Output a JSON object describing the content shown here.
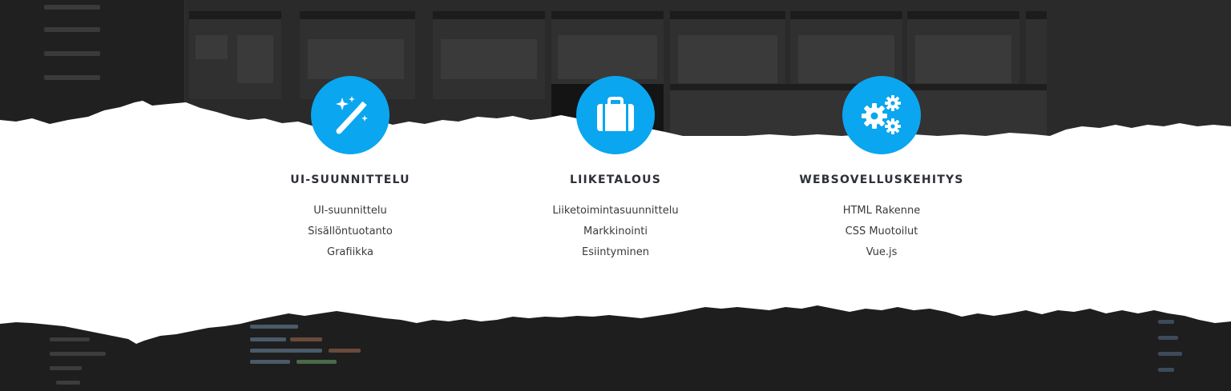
{
  "features": [
    {
      "icon": "magic-wand-icon",
      "title": "UI-SUUNNITTELU",
      "items": [
        "UI-suunnittelu",
        "Sisällöntuotanto",
        "Grafiikka"
      ]
    },
    {
      "icon": "briefcase-icon",
      "title": "LIIKETALOUS",
      "items": [
        "Liiketoimintasuunnittelu",
        "Markkinointi",
        "Esiintyminen"
      ]
    },
    {
      "icon": "gears-icon",
      "title": "WEBSOVELLUSKEHITYS",
      "items": [
        "HTML Rakenne",
        "CSS Muotoilut",
        "Vue.js"
      ]
    }
  ],
  "colors": {
    "accent": "#0aa6f0",
    "title_text": "#2d3038",
    "body_text": "#3a3a3a",
    "background_dark": "#262626",
    "paper": "#ffffff"
  }
}
